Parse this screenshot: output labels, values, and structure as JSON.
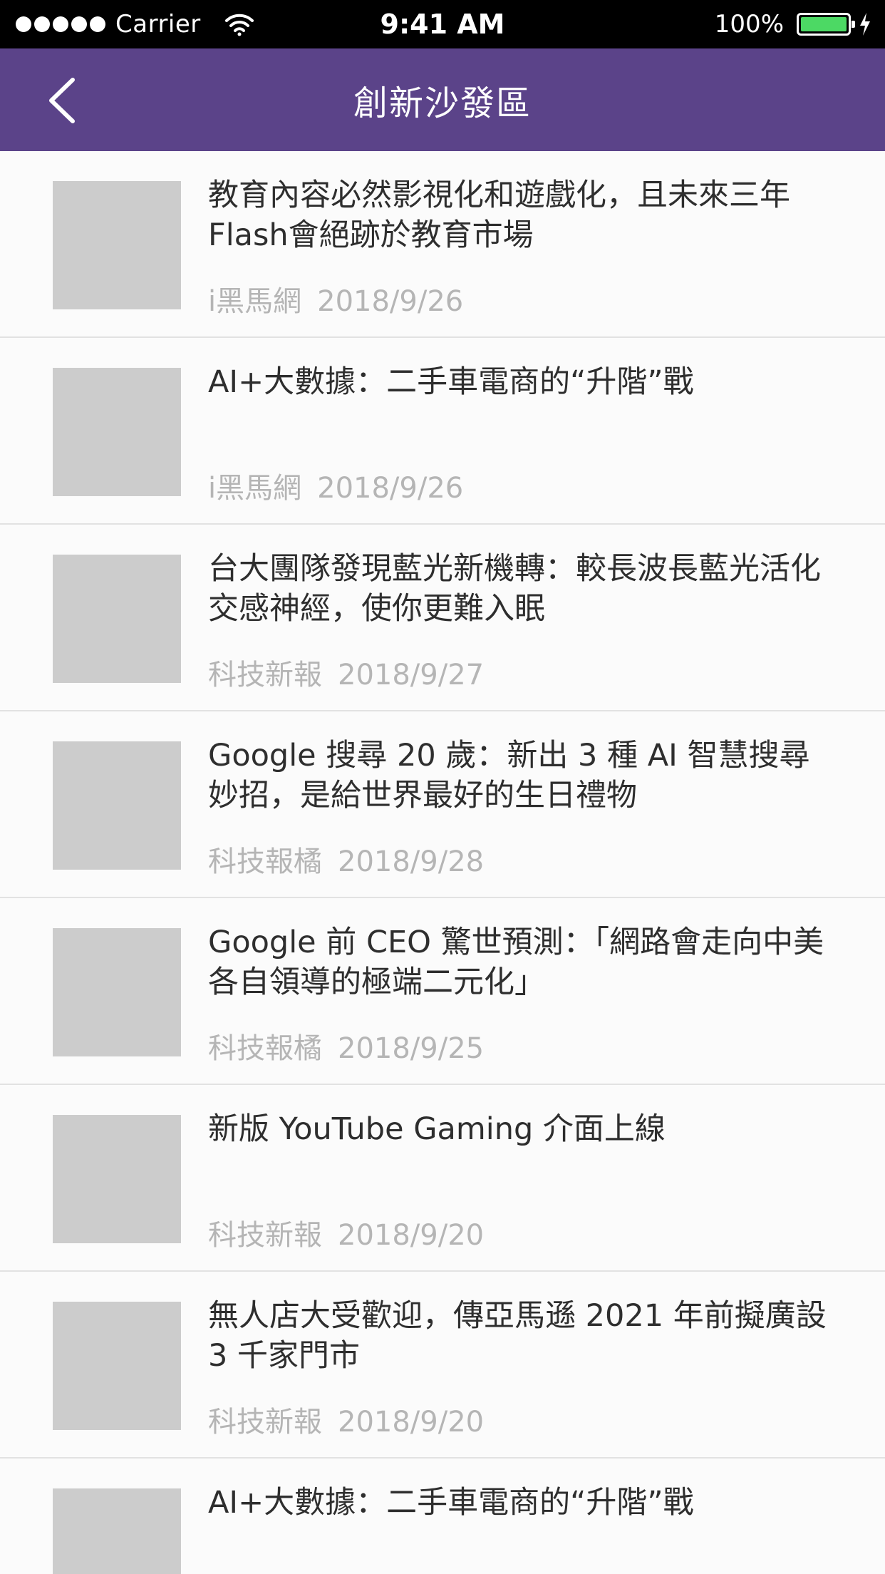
{
  "status_bar": {
    "carrier": "Carrier",
    "time": "9:41 AM",
    "battery": "100%",
    "battery_color": "#4cd964"
  },
  "nav": {
    "title": "創新沙發區",
    "back_icon": "chevron-left-icon",
    "background_color": "#5b4389"
  },
  "articles": [
    {
      "title": "教育內容必然影視化和遊戲化，且未來三年Flash會絕跡於教育市場",
      "source": "i黑馬網",
      "date": "2018/9/26"
    },
    {
      "title": "AI+大數據：二手車電商的“升階”戰",
      "source": "i黑馬網",
      "date": "2018/9/26"
    },
    {
      "title": "台大團隊發現藍光新機轉：較長波長藍光活化交感神經，使你更難入眠",
      "source": "科技新報",
      "date": "2018/9/27"
    },
    {
      "title": "Google 搜尋 20 歲：新出 3 種 AI 智慧搜尋妙招，是給世界最好的生日禮物",
      "source": "科技報橘",
      "date": "2018/9/28"
    },
    {
      "title": "Google 前 CEO 驚世預測：「網路會走向中美各自領導的極端二元化」",
      "source": "科技報橘",
      "date": "2018/9/25"
    },
    {
      "title": "新版 YouTube Gaming 介面上線",
      "source": "科技新報",
      "date": "2018/9/20"
    },
    {
      "title": " 無人店大受歡迎，傳亞馬遜 2021 年前擬廣設 3 千家門市",
      "source": "科技新報",
      "date": "2018/9/20"
    },
    {
      "title": "AI+大數據：二手車電商的“升階”戰",
      "source": "",
      "date": ""
    }
  ]
}
